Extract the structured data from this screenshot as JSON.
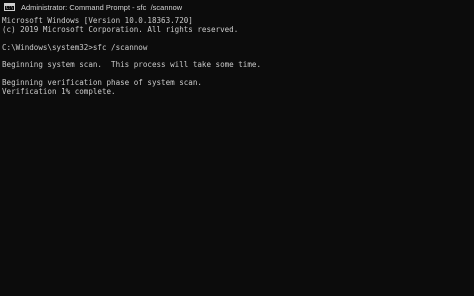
{
  "window": {
    "title": "Administrator: Command Prompt - sfc  /scannow",
    "icon_name": "command-prompt-icon",
    "icon_glyph": "C:\\"
  },
  "console": {
    "lines": [
      "Microsoft Windows [Version 10.0.18363.720]",
      "(c) 2019 Microsoft Corporation. All rights reserved.",
      "",
      "C:\\Windows\\system32>sfc /scannow",
      "",
      "Beginning system scan.  This process will take some time.",
      "",
      "Beginning verification phase of system scan.",
      "Verification 1% complete."
    ]
  },
  "colors": {
    "background": "#0c0c0c",
    "text": "#cccccc"
  }
}
